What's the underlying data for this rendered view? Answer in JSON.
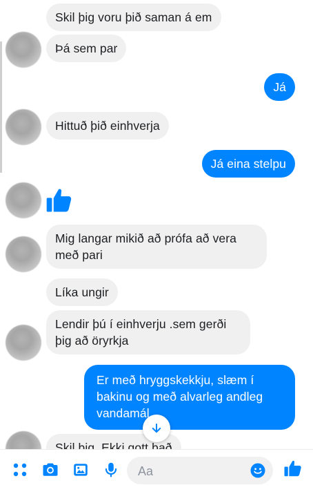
{
  "messages": [
    {
      "from": "them",
      "text": "Skil þig voru þið saman á em"
    },
    {
      "from": "them",
      "text": "Þá sem par"
    },
    {
      "from": "me",
      "text": "Já"
    },
    {
      "from": "them",
      "text": "Hittuð þið einhverja"
    },
    {
      "from": "me",
      "text": "Já eina stelpu"
    },
    {
      "from": "them",
      "icon": "thumbs-up-icon"
    },
    {
      "from": "them",
      "text": "Mig langar mikið að prófa að vera með pari"
    },
    {
      "from": "them",
      "text": "Líka ungir"
    },
    {
      "from": "them",
      "text": "Lendir þú í einhverju .sem gerði þig að öryrkja"
    },
    {
      "from": "me",
      "text": "Er með hryggskekkju, slæm í bakinu og með alvarleg andleg vandamál"
    },
    {
      "from": "them",
      "text": "Skil þig. Ekki gott það"
    }
  ],
  "composer": {
    "placeholder": "Aa",
    "icons": [
      "apps-icon",
      "camera-icon",
      "gallery-icon",
      "microphone-icon",
      "emoji-icon",
      "thumbs-up-icon"
    ]
  },
  "colors": {
    "accent": "#0084ff",
    "incoming_bubble": "#f0f0f0",
    "outgoing_text": "#ffffff"
  }
}
